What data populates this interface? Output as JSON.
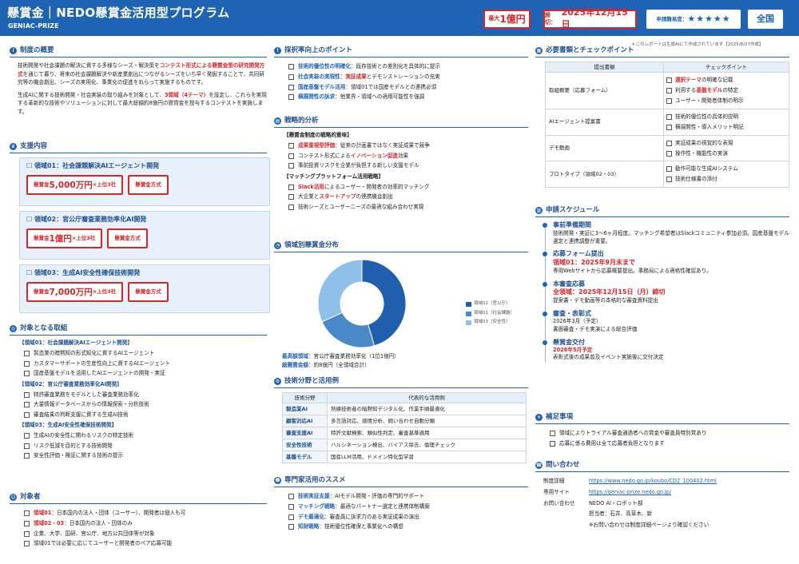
{
  "header": {
    "title": "懸賞金｜NEDO懸賞金活用型プログラム",
    "subtitle": "GENIAC-PRIZE",
    "box1_small": "最大",
    "box1_big": "1億円",
    "box2_small": "締切：",
    "box2_big": "2025年12月15日",
    "box3_small": "申請難易度：",
    "box3_stars": "★★★★★",
    "box4": "全国"
  },
  "note": "＊このレポートは生成AIにて作成されています【2025/8/27作成】",
  "overview": {
    "title": "制度の概要",
    "p1a": "技術開発や社会課題の解決に資する多様なシーズ・解決策を",
    "p1r": "コンテスト形式による懸賞金型の研究開発方式",
    "p1b": "を通じて募り、将来の社会課題解決や新産業創出につながるシーズをいち早く発掘することで、共同研究等の機会創出、シーズの実用化、事業化の促進をねらって実施するものです。",
    "p2a": "生成AIに関する技術開発・社会実装の取り組みを対象として、",
    "p2r": "3領域（4テーマ）",
    "p2b": "を設定し、これらを実現する革新的な技術やソリューションに対して最大総額約8億円の懸賞金を授与するコンテストを実施します。"
  },
  "support": {
    "title": "支援内容",
    "domains": [
      {
        "name": "領域01：社会課題解決AIエージェント開発",
        "pre": "懸賞金",
        "amount": "5,000万円",
        "post": "×上位3社",
        "method": "懸賞金方式"
      },
      {
        "name": "領域02：官公庁審査業務効率化AI開発",
        "pre": "懸賞金",
        "amount": "1億円",
        "post": "×上位3社",
        "method": "懸賞金方式"
      },
      {
        "name": "領域03：生成AI安全性確保技術開発",
        "pre": "懸賞金",
        "amount": "7,000万円",
        "post": "×上位3社",
        "method": "懸賞金方式"
      }
    ]
  },
  "targets": {
    "title": "対象となる取組",
    "groups": [
      {
        "name": "【領域01：社会課題解決AIエージェント開発】",
        "items": [
          "製造業の暗黙知の形式知化に資するAIエージェント",
          "カスタマーサポートの生産性向上に資するAIエージェント",
          "国産基盤モデルを活用したAIエージェントの開発・実証"
        ]
      },
      {
        "name": "【領域02：官公庁審査業務効率化AI開発】",
        "items": [
          "特許審査業務をモデルとした審査業務効率化",
          "大量情報データベースからの情報探索・分析技術",
          "審査結果の判断支援に資する生成AI技術"
        ]
      },
      {
        "name": "【領域03：生成AI安全性確保技術開発】",
        "items": [
          "生成AIの安全性に関わるリスクの特定技術",
          "リスク低減を目的とする技術開発",
          "安全性評価・検証に関する技術の提示"
        ]
      }
    ]
  },
  "eligibility": {
    "title": "対象者",
    "items": [
      {
        "r": "領域01",
        "t": "：日本国内の法人・団体（ユーザー）、開発者は個人も可"
      },
      {
        "r": "領域02・03",
        "t": "：日本国内の法人・団体のみ"
      },
      {
        "r": "",
        "t": "企業、大学、国研、官公庁、地方公共団体等が対象"
      },
      {
        "r": "",
        "t": "領域01では必要に応じてユーザーと開発者のペア応募可能"
      }
    ]
  },
  "points": {
    "title": "採択率向上のポイント",
    "items": [
      {
        "a": "技術的優位性の明確化",
        "b": "：既存技術との差別化を具体的に提示",
        "c": ""
      },
      {
        "a": "社会実装の実現性",
        "b": "：",
        "r": "実証成果",
        "c": "とデモンストレーションの充実"
      },
      {
        "a": "国産基盤モデル活用",
        "b": "：領域01では国産モデルとの連携必須",
        "c": ""
      },
      {
        "a": "横展開性の訴求",
        "b": "：他業界・領域への適用可能性を強調",
        "c": ""
      }
    ]
  },
  "strategy": {
    "title": "戦略的分析",
    "g1": "【懸賞金制度の戦略的意味】",
    "g1items": [
      {
        "r": "成果重視型評価",
        "t": "：従来の計画書ではなく実証成果で競争"
      },
      {
        "p": "コンテスト形式による",
        "r": "イノベーション促進",
        "t": "効果"
      },
      {
        "p": "",
        "r": "",
        "t": "事前投資リスクを企業が負担する新しい支援モデル"
      }
    ],
    "g2": "【マッチングプラットフォーム活用戦略】",
    "g2items": [
      {
        "r": "Slack活用",
        "t": "によるユーザー・開発者の効率的マッチング"
      },
      {
        "p": "大企業と",
        "r": "スタートアップ",
        "t": "の連携機会創出"
      },
      {
        "p": "",
        "r": "",
        "t": "技術シーズとユーザーニーズの最適な組み合わせ実現"
      }
    ]
  },
  "distribution": {
    "title": "領域別懸賞金分布",
    "legend": [
      "領域02（官公庁）",
      "領域01（社会課題）",
      "領域03（安全性）"
    ],
    "l1": "最高額領域",
    "v1": "：官公庁審査業務効率化（1位1億円）",
    "l2": "総懸賞金額",
    "v2": "：約8億円（全領域合計）"
  },
  "chart_data": {
    "type": "pie",
    "categories": [
      "領域02（官公庁）",
      "領域01（社会課題）",
      "領域03（安全性）"
    ],
    "values": [
      1.0,
      0.5,
      0.7
    ],
    "colors": [
      "#1f5fae",
      "#4a89c8",
      "#8ec0ea"
    ]
  },
  "techfields": {
    "title": "技術分野と活用例",
    "h1": "技術分野",
    "h2": "代表的な活用例",
    "rows": [
      [
        "製造業AI",
        "熟練技術者の暗黙知デジタル化、作業手順最適化"
      ],
      [
        "顧客対応AI",
        "多言語対応、感情分析、問い合わせ自動分類"
      ],
      [
        "審査支援AI",
        "特許文献検索、類似性判定、審査基準適用"
      ],
      [
        "安全性技術",
        "ハルシネーション検出、バイアス除去、倫理チェック"
      ],
      [
        "基盤モデル",
        "国産LLM活用、ドメイン特化型学習"
      ]
    ]
  },
  "experts": {
    "title": "専門家活用のススメ",
    "items": [
      {
        "a": "技術実証支援",
        "b": "：AIモデル開発・評価の専門的サポート"
      },
      {
        "a": "マッチング戦略",
        "b": "：最適なパートナー選定と連携体制構築"
      },
      {
        "a": "デモ最適化",
        "b": "：審査員に訴求力のある実証成果の演出"
      },
      {
        "a": "知財戦略",
        "b": "：技術優位性確保と事業化への構想"
      }
    ]
  },
  "docs": {
    "title": "必要書類とチェックポイント",
    "h1": "提出書類",
    "h2": "チェックポイント",
    "rows": [
      {
        "doc": "取組概要（応募フォーム）",
        "checks": [
          {
            "p": "",
            "r": "選択テーマ",
            "t": "の明確な記載"
          },
          {
            "p": "利用する",
            "r": "基盤モデル",
            "t": "の特定"
          },
          {
            "p": "",
            "r": "",
            "t": "ユーザー・開発者体制の明示"
          }
        ]
      },
      {
        "doc": "AIエージェント提案書",
        "checks": [
          {
            "p": "",
            "r": "",
            "t": "技術的優位性の具体的説明"
          },
          {
            "p": "",
            "r": "",
            "t": "横展開性・導入メリット明記"
          }
        ]
      },
      {
        "doc": "デモ動画",
        "checks": [
          {
            "p": "",
            "r": "",
            "t": "実証成果の視覚的な表現"
          },
          {
            "p": "",
            "r": "",
            "t": "操作性・機能性の実演"
          }
        ]
      },
      {
        "doc": "プロトタイプ（領域02・03）",
        "checks": [
          {
            "p": "",
            "r": "",
            "t": "動作可能な生成AIシステム"
          },
          {
            "p": "",
            "r": "",
            "t": "技術仕様書の添付"
          }
        ]
      }
    ]
  },
  "schedule": {
    "title": "申請スケジュール",
    "items": [
      {
        "t": "事前準備期間",
        "hl": "",
        "d": "技術開発・実証に3〜6ヶ月程度。マッチング希望者はSlackコミュニティ参加必須。国産基盤モデル選定と連携調整が重要。"
      },
      {
        "t": "応募フォーム提出",
        "hl": "領域01：2025年9月末まで",
        "d": "専用Webサイトから応募概要提出。事務局による適格性確認あり。"
      },
      {
        "t": "本審査応募",
        "hl": "全領域：2025年12月15日（月）締切",
        "d": "提案書・デモ動画等の本格的な審査資料提出"
      },
      {
        "t": "審査・表彰式",
        "hl": "",
        "d": "2026年3月（予定）\n書面審査・デモ実演による総合評価"
      },
      {
        "t": "懸賞金交付",
        "hl": "2026年5月予定",
        "d": "表彰式後の成果普及イベント実施後に交付決定"
      }
    ]
  },
  "supplement": {
    "title": "補足事項",
    "items": [
      "領域によりトライアル審査通過者への賞金や審査員特別賞あり",
      "応募に係る費用は全て応募者負担となります"
    ]
  },
  "contact": {
    "title": "問い合わせ",
    "l1": "制度詳細",
    "v1": "https://www.nedo.go.jp/koubo/CD2_100402.html",
    "l2": "専用サイト",
    "v2": "https://geniac-prize.nedo.go.jp/",
    "l3": "お問い合わせ",
    "v3": "NEDO AI・ロボット部",
    "v4": "担当者：石井、高草木、新",
    "v5": "※お問い合わせは制度詳細ページより確認ください"
  }
}
